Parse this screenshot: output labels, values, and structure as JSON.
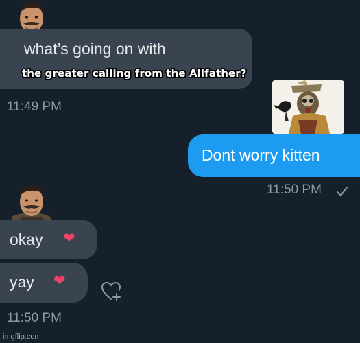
{
  "messages": {
    "m1_text": "what’s going on with",
    "m1_overlay": "the greater calling from the Allfather?",
    "m1_time": "11:49 PM",
    "m2_text": "Dont worry kitten",
    "m2_time": "11:50 PM",
    "m2_status_icon": "check-mark",
    "m3_text": "okay",
    "m4_text": "yay",
    "m4_time": "11:50 PM",
    "heart_glyph": "❤"
  },
  "reaction_button_icon": "add-reaction-heart-icon",
  "watermark": "imgflip.com",
  "colors": {
    "background": "#16202b",
    "received_bubble": "#3a4451",
    "sent_bubble": "#1d9bf0",
    "timestamp": "#8b98a5",
    "heart": "#f0426a"
  }
}
